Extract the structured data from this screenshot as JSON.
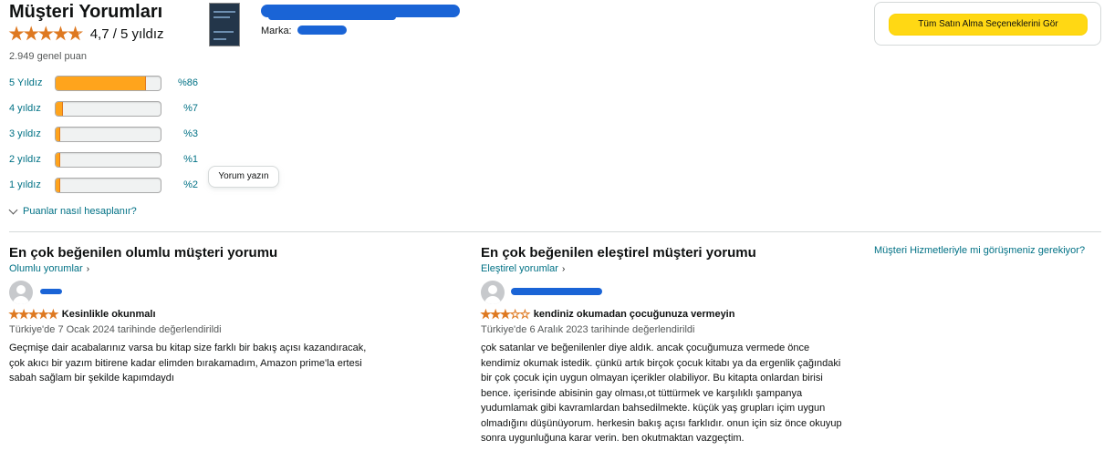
{
  "summary": {
    "title": "Müşteri Yorumları",
    "average_rating": 4.7,
    "average_text": "4,7 / 5 yıldız",
    "total_ratings": "2.949 genel puan"
  },
  "histogram": [
    {
      "label": "5 Yıldız",
      "percent_text": "%86",
      "fraction": 0.86
    },
    {
      "label": "4 yıldız",
      "percent_text": "%7",
      "fraction": 0.07
    },
    {
      "label": "3 yıldız",
      "percent_text": "%3",
      "fraction": 0.03
    },
    {
      "label": "2 yıldız",
      "percent_text": "%1",
      "fraction": 0.01
    },
    {
      "label": "1 yıldız",
      "percent_text": "%2",
      "fraction": 0.02
    }
  ],
  "write_review_label": "Yorum yazın",
  "how_calculated_label": "Puanlar nasıl hesaplanır?",
  "product": {
    "brand_label": "Marka:"
  },
  "buy_box": {
    "button_label": "Tüm Satın Alma Seçeneklerini Gör"
  },
  "positive": {
    "heading": "En çok beğenilen olumlu müşteri yorumu",
    "link": "Olumlu yorumlar",
    "rating": 5,
    "title": "Kesinlikle okunmalı",
    "date": "Türkiye'de 7 Ocak 2024 tarihinde değerlendirildi",
    "body_lines": [
      "Geçmişe dair acabalarınız varsa bu kitap size farklı bir bakış açısı kazandıracak,",
      "çok akıcı bir yazım bitirene kadar elimden bırakamadım, Amazon prime'la ertesi",
      "sabah sağlam bir şekilde kapımdaydı"
    ]
  },
  "critical": {
    "heading": "En çok beğenilen eleştirel müşteri yorumu",
    "link": "Eleştirel yorumlar",
    "rating": 3,
    "title": "kendiniz okumadan çocuğunuza vermeyin",
    "date": "Türkiye'de 6 Aralık 2023 tarihinde değerlendirildi",
    "body_lines": [
      "çok satanlar ve beğenilenler diye aldık. ancak çocuğumuza vermede önce",
      "kendimiz okumak istedik. çünkü artık birçok çocuk kitabı ya da ergenlik çağındaki",
      "bir çok çocuk için uygun olmayan içerikler olabiliyor. Bu kitapta onlardan birisi",
      "bence. içerisinde abisinin gay olması,ot tüttürmek ve karşılıklı şampanya",
      "yudumlamak gibi kavramlardan bahsedilmekte. küçük yaş grupları içim uygun",
      "olmadığını düşünüyorum. herkesin bakış açısı farklıdır. onun için siz önce okuyup",
      "sonra uygunluğuna karar verin. ben okutmaktan vazgeçtim."
    ]
  },
  "customer_service_link": "Müşteri Hizmetleriyle mi görüşmeniz gerekiyor?",
  "colors": {
    "star": "#DE7921",
    "bar_fill": "#FFA41C",
    "link": "#007185",
    "buy_button": "#FFD814",
    "redaction": "#1a64d6"
  }
}
